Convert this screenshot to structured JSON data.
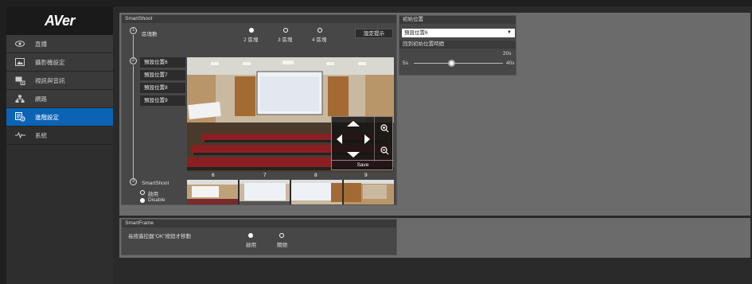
{
  "brand": {
    "logo": "AVer"
  },
  "sidebar": {
    "items": [
      {
        "label": "直播",
        "icon": "eye-icon"
      },
      {
        "label": "攝影機設定",
        "icon": "image-icon"
      },
      {
        "label": "視訊與音訊",
        "icon": "video-audio-icon"
      },
      {
        "label": "網路",
        "icon": "network-icon"
      },
      {
        "label": "進階設定",
        "icon": "advanced-settings-icon"
      },
      {
        "label": "系統",
        "icon": "system-pulse-icon"
      }
    ],
    "active_index": 4,
    "active_color": "#0a63b5"
  },
  "smartshoot": {
    "title": "SmartShoot",
    "step1_label": "區塊數",
    "options": [
      "2 區塊",
      "3 區塊",
      "4 區塊"
    ],
    "selected_option": "2 區塊",
    "hint_button": "設定提示",
    "presets": [
      "預設位置6",
      "預設位置7",
      "預設位置8",
      "預設位置9"
    ],
    "thumb_labels": [
      "6",
      "7",
      "8",
      "9"
    ],
    "ptz_save": "Save",
    "step3_label": "SmartShoot",
    "enable": "啟用",
    "disable": "Disable",
    "selected_state": "Disable"
  },
  "initial_position": {
    "title": "初始位置",
    "selected": "預設位置6",
    "return_time_label": "回到初始位置時間",
    "return_time_value": "20s",
    "min": "5s",
    "max": "40s"
  },
  "smartframe": {
    "title": "SmartFrame",
    "label": "長按遙控器\"OK\"按鈕才移動",
    "enable": "啟用",
    "disable": "關閉",
    "selected": "啟用"
  }
}
